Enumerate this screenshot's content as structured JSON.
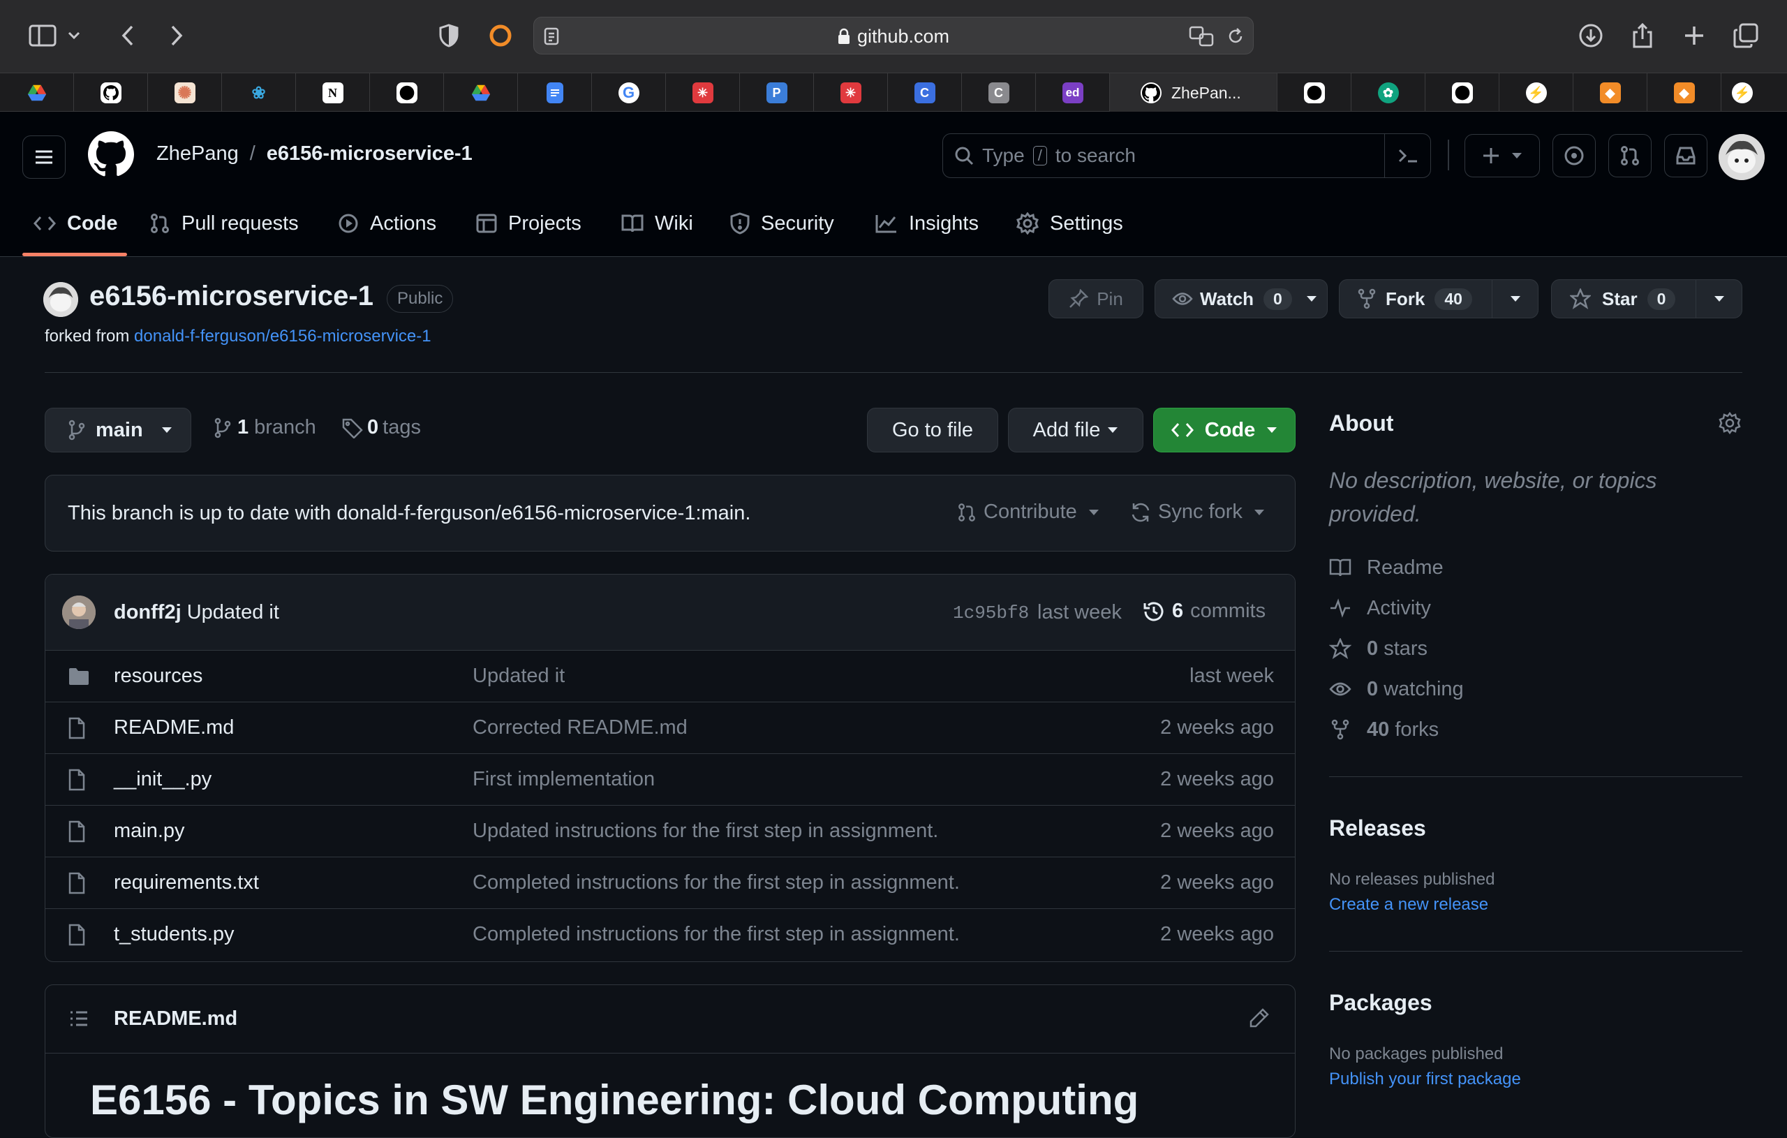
{
  "browser": {
    "url": "github.com",
    "active_tab_title": "ZhePan..."
  },
  "header": {
    "owner": "ZhePang",
    "separator": "/",
    "repo": "e6156-microservice-1",
    "search_prefix": "Type",
    "search_key": "/",
    "search_suffix": "to search"
  },
  "nav": {
    "code": "Code",
    "pulls": "Pull requests",
    "actions": "Actions",
    "projects": "Projects",
    "wiki": "Wiki",
    "security": "Security",
    "insights": "Insights",
    "settings": "Settings"
  },
  "repo": {
    "name": "e6156-microservice-1",
    "visibility": "Public",
    "forked_prefix": "forked from",
    "forked_link": "donald-f-ferguson/e6156-microservice-1",
    "pin": "Pin",
    "watch": "Watch",
    "watch_count": "0",
    "fork": "Fork",
    "fork_count": "40",
    "star": "Star",
    "star_count": "0"
  },
  "toolbar": {
    "branch": "main",
    "branch_count": "1",
    "branch_word": "branch",
    "tag_count": "0",
    "tag_word": "tags",
    "go_to_file": "Go to file",
    "add_file": "Add file",
    "code": "Code"
  },
  "sync": {
    "message": "This branch is up to date with donald-f-ferguson/e6156-microservice-1:main.",
    "contribute": "Contribute",
    "sync_fork": "Sync fork"
  },
  "commit": {
    "author": "donff2j",
    "message": "Updated it",
    "sha": "1c95bf8",
    "time": "last week",
    "count": "6",
    "count_word": "commits"
  },
  "files": [
    {
      "name": "resources",
      "type": "folder",
      "message": "Updated it",
      "time": "last week"
    },
    {
      "name": "README.md",
      "type": "file",
      "message": "Corrected README.md",
      "time": "2 weeks ago"
    },
    {
      "name": "__init__.py",
      "type": "file",
      "message": "First implementation",
      "time": "2 weeks ago"
    },
    {
      "name": "main.py",
      "type": "file",
      "message": "Updated instructions for the first step in assignment.",
      "time": "2 weeks ago"
    },
    {
      "name": "requirements.txt",
      "type": "file",
      "message": "Completed instructions for the first step in assignment.",
      "time": "2 weeks ago"
    },
    {
      "name": "t_students.py",
      "type": "file",
      "message": "Completed instructions for the first step in assignment.",
      "time": "2 weeks ago"
    }
  ],
  "readme": {
    "filename": "README.md",
    "heading": "E6156 - Topics in SW Engineering: Cloud Computing"
  },
  "about": {
    "title": "About",
    "description": "No description, website, or topics provided.",
    "readme": "Readme",
    "activity": "Activity",
    "stars_count": "0",
    "stars_word": "stars",
    "watching_count": "0",
    "watching_word": "watching",
    "forks_count": "40",
    "forks_word": "forks"
  },
  "releases": {
    "title": "Releases",
    "empty": "No releases published",
    "link": "Create a new release"
  },
  "packages": {
    "title": "Packages",
    "empty": "No packages published",
    "link": "Publish your first package"
  },
  "colors": {
    "bg": "#0d1117",
    "header_bg": "#010409",
    "accent_link": "#4493f8",
    "green_button": "#238636",
    "nav_underline": "#f78166"
  }
}
